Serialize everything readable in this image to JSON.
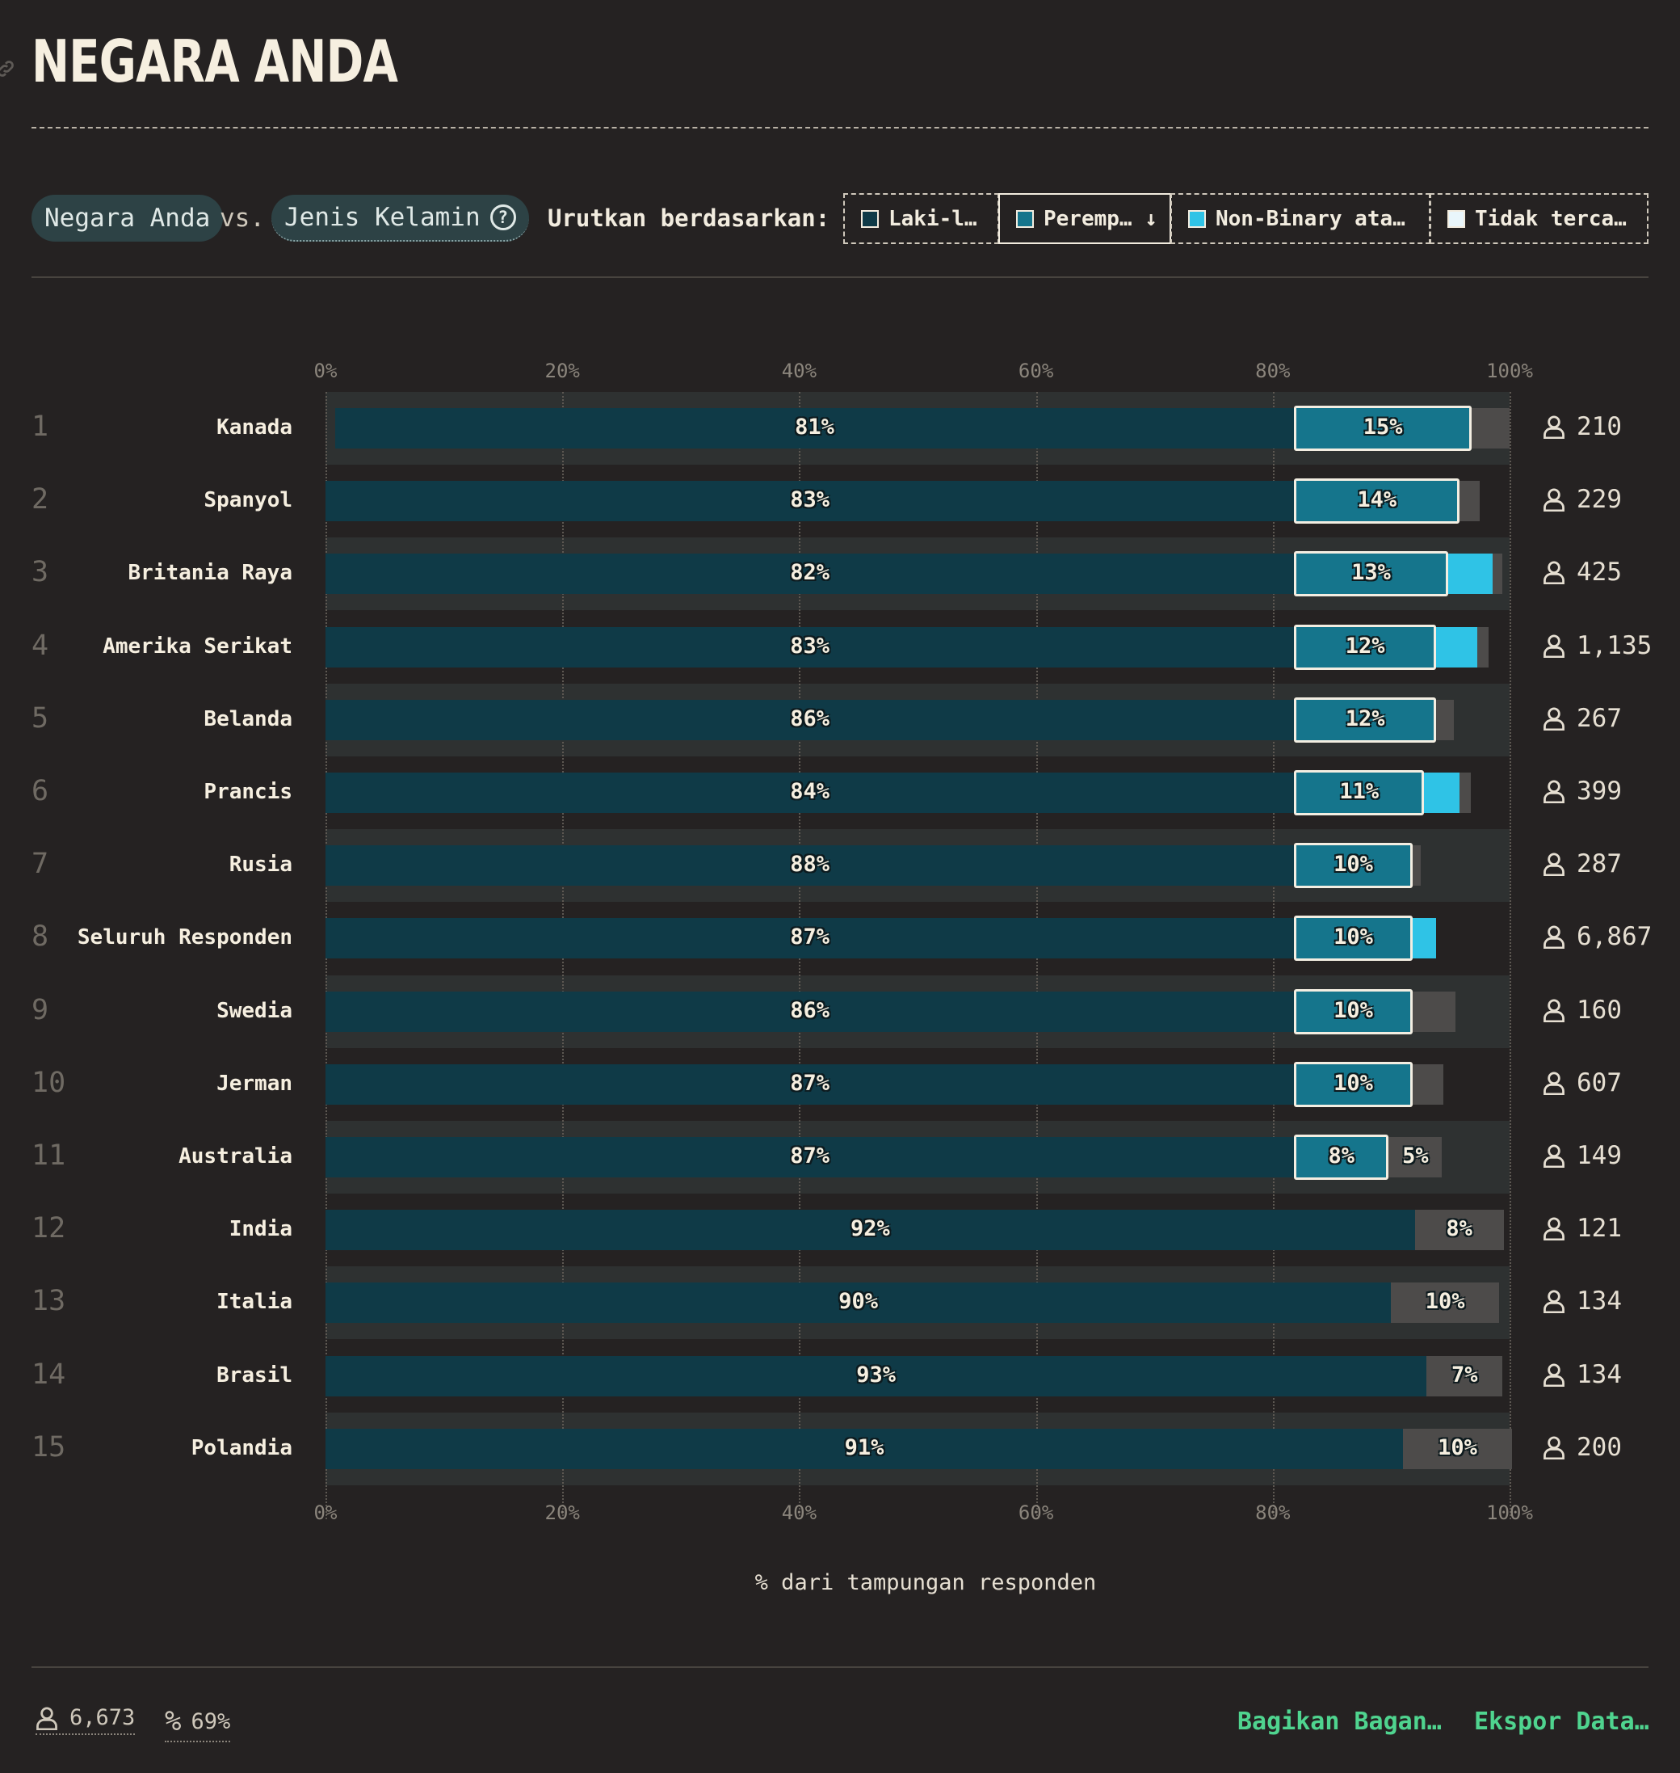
{
  "title": "NEGARA ANDA",
  "controls": {
    "pill_left": "Negara Anda",
    "vs": "vs.",
    "pill_right": "Jenis Kelamin",
    "help_glyph": "?",
    "sort_label": "Urutkan berdasarkan:",
    "sort_options": [
      "Laki-l…",
      "Peremp… ↓",
      "Non-Binary ata…",
      "Tidak terca…"
    ],
    "sort_swatch_colors": [
      "#0f3a47",
      "#15758c",
      "#2fc3e6",
      "#e9f6fb"
    ]
  },
  "colors": {
    "male": "#0f3a47",
    "female": "#15758c",
    "nonbinary": "#2fc3e6",
    "not_listed": "#4d4b4a",
    "accent_link": "#4fd48f"
  },
  "chart_data": {
    "type": "bar",
    "orientation": "horizontal",
    "stacked": true,
    "xlabel": "% dari tampungan responden",
    "xlim": [
      0,
      100
    ],
    "x_ticks": [
      "0%",
      "20%",
      "40%",
      "60%",
      "80%",
      "100%"
    ],
    "grid": true,
    "series_names": [
      "Laki-l…",
      "Peremp…",
      "Non-Binary ata…",
      "Tidak terca…"
    ],
    "rows": [
      {
        "rank": "1",
        "country": "Kanada",
        "male": 81,
        "female": 15,
        "nonbinary": 0,
        "not_listed": 3.2,
        "male_label": "81%",
        "female_label": "15%",
        "other_label": "",
        "count": "210"
      },
      {
        "rank": "2",
        "country": "Spanyol",
        "male": 83,
        "female": 14,
        "nonbinary": 0,
        "not_listed": 1.7,
        "male_label": "83%",
        "female_label": "14%",
        "other_label": "",
        "count": "229"
      },
      {
        "rank": "3",
        "country": "Britania Raya",
        "male": 82,
        "female": 13,
        "nonbinary": 3.8,
        "not_listed": 0.8,
        "male_label": "82%",
        "female_label": "13%",
        "other_label": "",
        "count": "425"
      },
      {
        "rank": "4",
        "country": "Amerika Serikat",
        "male": 83,
        "female": 12,
        "nonbinary": 3.5,
        "not_listed": 0.9,
        "male_label": "83%",
        "female_label": "12%",
        "other_label": "",
        "count": "1,135"
      },
      {
        "rank": "5",
        "country": "Belanda",
        "male": 86,
        "female": 12,
        "nonbinary": 0,
        "not_listed": 1.5,
        "male_label": "86%",
        "female_label": "12%",
        "other_label": "",
        "count": "267"
      },
      {
        "rank": "6",
        "country": "Prancis",
        "male": 84,
        "female": 11,
        "nonbinary": 3.0,
        "not_listed": 0.9,
        "male_label": "84%",
        "female_label": "11%",
        "other_label": "",
        "count": "399"
      },
      {
        "rank": "7",
        "country": "Rusia",
        "male": 88,
        "female": 10,
        "nonbinary": 0,
        "not_listed": 0.7,
        "male_label": "88%",
        "female_label": "10%",
        "other_label": "",
        "count": "287"
      },
      {
        "rank": "8",
        "country": "Seluruh Responden",
        "male": 87,
        "female": 10,
        "nonbinary": 2.0,
        "not_listed": 0,
        "male_label": "87%",
        "female_label": "10%",
        "other_label": "",
        "count": "6,867"
      },
      {
        "rank": "9",
        "country": "Swedia",
        "male": 86,
        "female": 10,
        "nonbinary": 0,
        "not_listed": 3.6,
        "male_label": "86%",
        "female_label": "10%",
        "other_label": "",
        "count": "160"
      },
      {
        "rank": "10",
        "country": "Jerman",
        "male": 87,
        "female": 10,
        "nonbinary": 0,
        "not_listed": 2.6,
        "male_label": "87%",
        "female_label": "10%",
        "other_label": "",
        "count": "607"
      },
      {
        "rank": "11",
        "country": "Australia",
        "male": 87,
        "female": 8,
        "nonbinary": 0,
        "not_listed": 4.5,
        "male_label": "87%",
        "female_label": "8%",
        "other_label": "5%",
        "count": "149"
      },
      {
        "rank": "12",
        "country": "India",
        "male": 92,
        "female": 0,
        "nonbinary": 0,
        "not_listed": 7.5,
        "male_label": "92%",
        "female_label": "",
        "other_label": "8%",
        "count": "121"
      },
      {
        "rank": "13",
        "country": "Italia",
        "male": 90,
        "female": 0,
        "nonbinary": 0,
        "not_listed": 9.1,
        "male_label": "90%",
        "female_label": "",
        "other_label": "10%",
        "count": "134"
      },
      {
        "rank": "14",
        "country": "Brasil",
        "male": 93,
        "female": 0,
        "nonbinary": 0,
        "not_listed": 6.4,
        "male_label": "93%",
        "female_label": "",
        "other_label": "7%",
        "count": "134"
      },
      {
        "rank": "15",
        "country": "Polandia",
        "male": 91,
        "female": 0,
        "nonbinary": 0,
        "not_listed": 9.2,
        "male_label": "91%",
        "female_label": "",
        "other_label": "10%",
        "count": "200"
      }
    ]
  },
  "footer": {
    "respondents": "6,673",
    "percent": "69%",
    "share": "Bagikan Bagan…",
    "export": "Ekspor Data…"
  }
}
